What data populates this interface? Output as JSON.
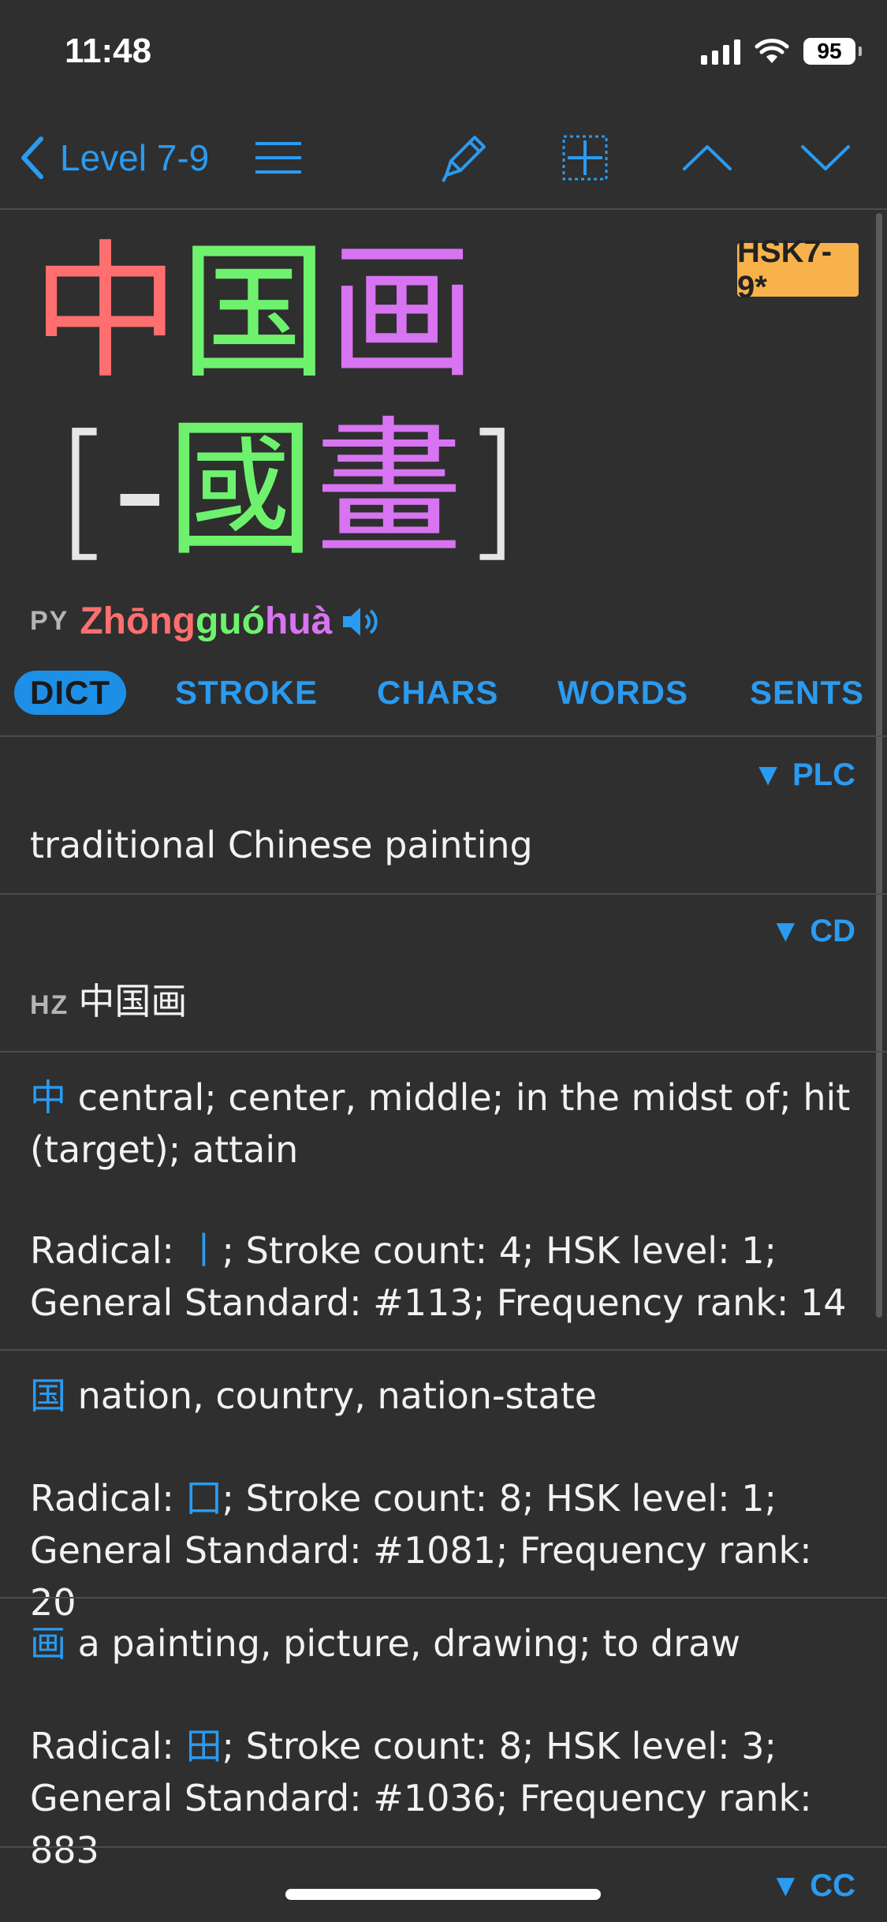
{
  "status": {
    "time": "11:48",
    "battery": "95"
  },
  "nav": {
    "back_label": "Level 7-9"
  },
  "headword": {
    "badge": "HSK7-9*",
    "chars": [
      {
        "text": "中",
        "color": "#ff6f6f"
      },
      {
        "text": "国",
        "color": "#6ef26e"
      },
      {
        "text": "画",
        "color": "#d874f2"
      }
    ],
    "trad_open": "[",
    "trad_chars": [
      {
        "text": "-",
        "color": "#e6e6e6"
      },
      {
        "text": "國",
        "color": "#6ef26e"
      },
      {
        "text": "畫",
        "color": "#d874f2"
      }
    ],
    "trad_close": "]",
    "py_label": "PY",
    "pinyin": [
      {
        "text": "Zhōng",
        "color": "#ff6f6f"
      },
      {
        "text": "guó",
        "color": "#6ef26e"
      },
      {
        "text": "huà",
        "color": "#d874f2"
      }
    ]
  },
  "tabs": [
    {
      "label": "DICT",
      "active": true
    },
    {
      "label": "STROKE",
      "active": false
    },
    {
      "label": "CHARS",
      "active": false
    },
    {
      "label": "WORDS",
      "active": false
    },
    {
      "label": "SENTS",
      "active": false
    }
  ],
  "sections": {
    "plc": {
      "tag": "▼ PLC",
      "definition": "traditional Chinese painting"
    },
    "cd": {
      "tag": "▼ CD",
      "hz_label": "HZ",
      "hz_value": "中国画"
    },
    "char1": {
      "char": "中",
      "meaning": " central; center, middle; in the midst of; hit (target); attain",
      "radical_prefix": "Radical: ",
      "radical": "丨",
      "info_line1": "; Stroke count: 4; HSK level: 1;",
      "info_line2": "General Standard: #113; Frequency rank: 14"
    },
    "char2": {
      "char": "国",
      "meaning": " nation, country, nation-state",
      "radical_prefix": "Radical: ",
      "radical": "囗",
      "info_line1": "; Stroke count: 8; HSK level: 1;",
      "info_line2": "General Standard: #1081; Frequency rank: 20"
    },
    "char3": {
      "char": "画",
      "meaning": " a painting, picture, drawing; to draw",
      "radical_prefix": "Radical: ",
      "radical": "田",
      "info_line1": "; Stroke count: 8; HSK level: 3;",
      "info_line2": "General Standard: #1036; Frequency rank: 883"
    },
    "cc": {
      "tag": "▼ CC"
    }
  },
  "colors": {
    "accent": "#2a9bf0",
    "badge": "#f8b24c",
    "background": "#2f2f2f"
  }
}
